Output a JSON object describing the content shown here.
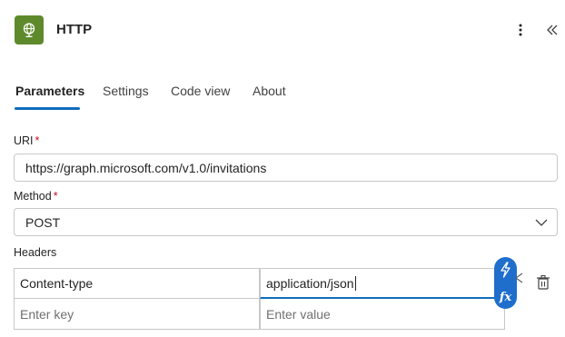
{
  "header": {
    "title": "HTTP",
    "icon": "globe-icon",
    "icon_bg": "#5f8a2c",
    "more_icon": "more-vertical-icon",
    "collapse_icon": "double-chevron-left-icon"
  },
  "tabs": [
    {
      "label": "Parameters",
      "active": true
    },
    {
      "label": "Settings",
      "active": false
    },
    {
      "label": "Code view",
      "active": false
    },
    {
      "label": "About",
      "active": false
    }
  ],
  "accent_color": "#0f6cbd",
  "uri": {
    "label": "URI",
    "required_mark": "*",
    "value": "https://graph.microsoft.com/v1.0/invitations"
  },
  "method": {
    "label": "Method",
    "required_mark": "*",
    "value": "POST"
  },
  "headers": {
    "label": "Headers",
    "rows": [
      {
        "key": "Content-type",
        "value": "application/json"
      },
      {
        "key_placeholder": "Enter key",
        "value_placeholder": "Enter value"
      }
    ],
    "expression_button": "fx",
    "dynamic_content_icon": "lightning-icon",
    "delete_icon": "delete-icon"
  }
}
